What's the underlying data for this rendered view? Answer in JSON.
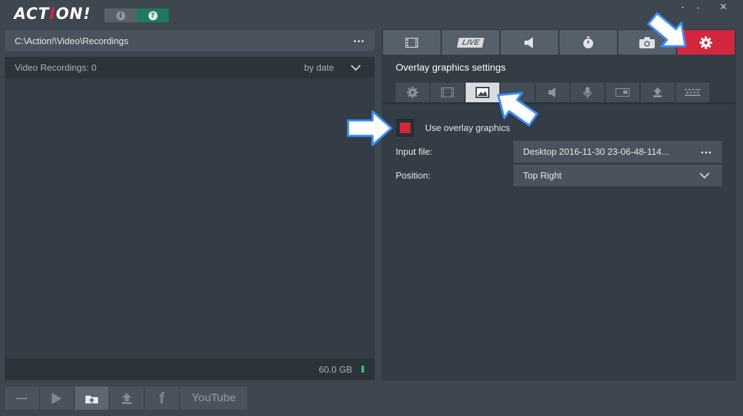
{
  "app": {
    "logo_main": "ACT",
    "logo_accent": "I",
    "logo_end": "ON!",
    "minimize_symbol": "-",
    "close_symbol": "✕",
    "info_symbol": "i",
    "help_symbol": "?"
  },
  "left": {
    "path": "C:\\Action!\\Video\\Recordings",
    "path_dots": "...",
    "list_title": "Video Recordings: 0",
    "sort_label": "by date",
    "storage": "60.0 GB"
  },
  "bottom_toolbar": {
    "youtube_label": "YouTube"
  },
  "tabs": {
    "live_label": "LIVE"
  },
  "overlay": {
    "section_title": "Overlay graphics settings",
    "use_overlay_label": "Use overlay graphics",
    "use_overlay_checked": true,
    "input_file_label": "Input file:",
    "input_file_value": "Desktop 2016-11-30 23-06-48-114...",
    "input_dots": "...",
    "position_label": "Position:",
    "position_value": "Top Right"
  },
  "colors": {
    "accent_red": "#d4263c",
    "help_green": "#1f7a5c",
    "arrow_blue": "#3a8cff"
  }
}
